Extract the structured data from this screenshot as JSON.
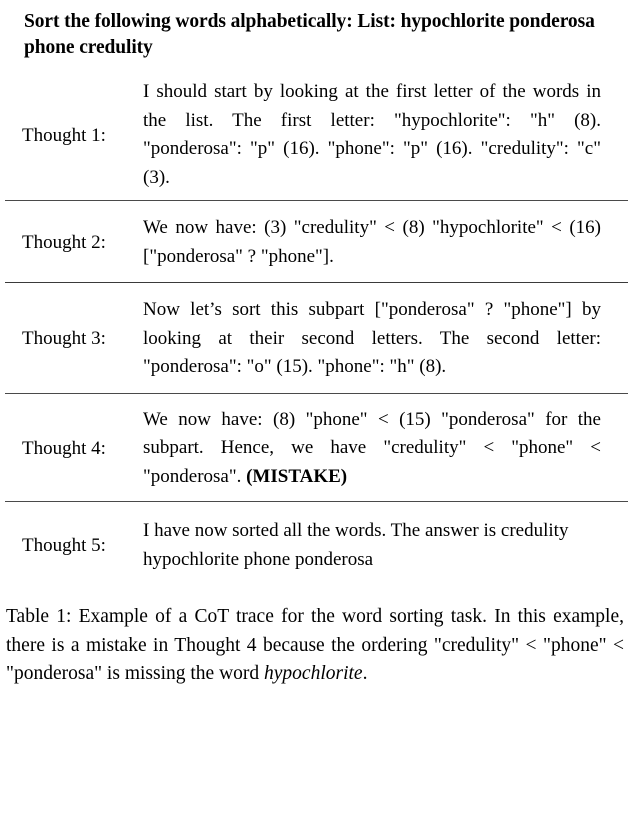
{
  "table": {
    "title": "Sort the following words alphabetically: List: hypochlorite ponderosa phone credulity",
    "rows": [
      {
        "label": "Thought 1:",
        "text": "I should start by looking at the first letter of the words in the list.  The first letter: \"hypochlorite\": \"h\" (8). \"ponderosa\": \"p\" (16). \"phone\": \"p\" (16). \"credulity\": \"c\" (3)."
      },
      {
        "label": "Thought 2:",
        "text": "We now have:  (3) \"credulity\" < (8) \"hypochlorite\" < (16) [\"ponderosa\" ? \"phone\"]."
      },
      {
        "label": "Thought 3:",
        "text": "Now let’s sort this subpart [\"ponderosa\" ? \"phone\"] by looking at their second letters. The second letter: \"ponderosa\": \"o\" (15). \"phone\": \"h\" (8)."
      },
      {
        "label": "Thought 4:",
        "text_main": "We now have:  (8) \"phone\" < (15) \"ponderosa\" for the subpart.  Hence, we have \"credulity\" < \"phone\" < \"ponderosa\". ",
        "text_bold": "(MISTAKE)"
      },
      {
        "label": "Thought 5:",
        "text": "I have now sorted all the words. The answer is credulity hypochlorite phone ponderosa"
      }
    ]
  },
  "caption": {
    "part1": "Table 1: Example of a CoT trace for the word sorting task. In this example, there is a mistake in Thought 4 because the ordering \"credulity\" < \"phone\" < \"ponderosa\" is missing the word ",
    "italic_word": "hypochlorite",
    "part2": "."
  }
}
